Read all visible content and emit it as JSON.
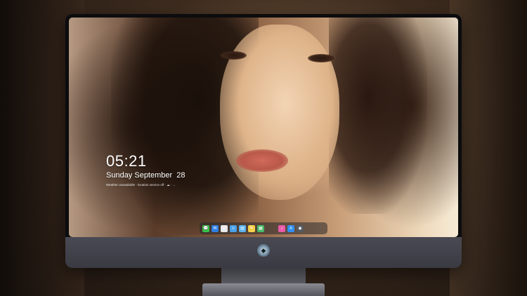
{
  "lockscreen": {
    "time": "05:21",
    "date": "Sunday September  28",
    "weather_line": "Weather unavailable · location service off · ☁ · ..."
  },
  "dock": {
    "icons": [
      {
        "name": "messages-icon",
        "glyph": "💬",
        "color": "#38c24a"
      },
      {
        "name": "mail-icon",
        "glyph": "✉",
        "color": "#2f7fe0"
      },
      {
        "name": "safari-icon",
        "glyph": "◎",
        "color": "#e8e8ea"
      },
      {
        "name": "finder-icon",
        "glyph": "☺",
        "color": "#4aa0e6"
      },
      {
        "name": "files-icon",
        "glyph": "▤",
        "color": "#5ab4f0"
      },
      {
        "name": "notes-icon",
        "glyph": "✎",
        "color": "#f4d04a"
      },
      {
        "name": "photos-icon",
        "glyph": "▦",
        "color": "#46b866"
      },
      {
        "name": "music-icon",
        "glyph": "♪",
        "color": "#e85aa8"
      },
      {
        "name": "appstore-icon",
        "glyph": "A",
        "color": "#2f8ff0"
      },
      {
        "name": "camera-icon",
        "glyph": "◉",
        "color": "#555a60"
      }
    ]
  },
  "monitor": {
    "logo_glyph": "◆"
  }
}
